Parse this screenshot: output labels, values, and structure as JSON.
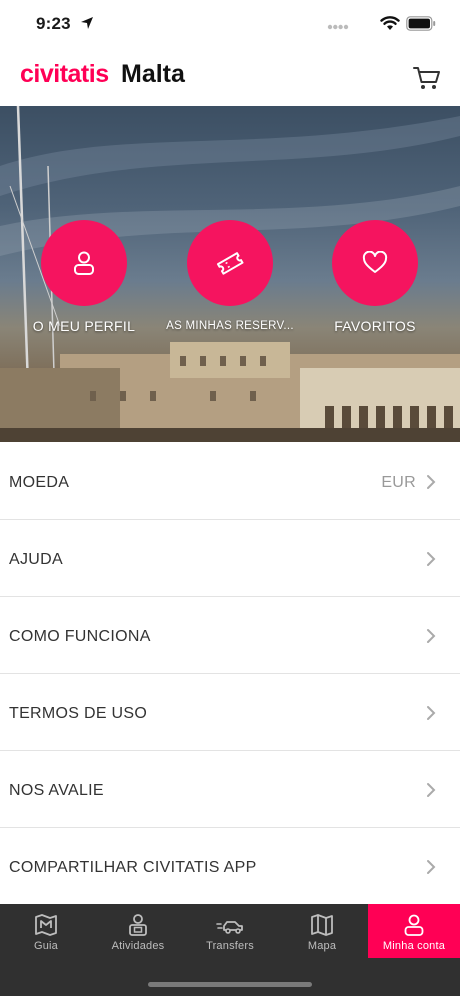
{
  "status_bar": {
    "time": "9:23"
  },
  "header": {
    "brand": "civitatis",
    "city": "Malta"
  },
  "hero": {
    "actions": [
      {
        "label": "O MEU PERFIL",
        "icon": "user-icon"
      },
      {
        "label": "AS MINHAS RESERV...",
        "icon": "ticket-icon"
      },
      {
        "label": "FAVORITOS",
        "icon": "heart-icon"
      }
    ]
  },
  "menu": {
    "items": [
      {
        "label": "MOEDA",
        "value": "EUR"
      },
      {
        "label": "AJUDA"
      },
      {
        "label": "COMO FUNCIONA"
      },
      {
        "label": "TERMOS DE USO"
      },
      {
        "label": "NOS AVALIE"
      },
      {
        "label": "COMPARTILHAR CIVITATIS APP"
      }
    ]
  },
  "tabbar": {
    "tabs": [
      {
        "label": "Guia",
        "icon": "map-book-icon"
      },
      {
        "label": "Atividades",
        "icon": "guide-person-icon"
      },
      {
        "label": "Transfers",
        "icon": "car-icon"
      },
      {
        "label": "Mapa",
        "icon": "map-icon"
      },
      {
        "label": "Minha conta",
        "icon": "user-icon",
        "active": true
      }
    ]
  },
  "colors": {
    "brand": "#ff0055",
    "tabbar_bg": "#303030",
    "hero_button": "#f5145f"
  }
}
